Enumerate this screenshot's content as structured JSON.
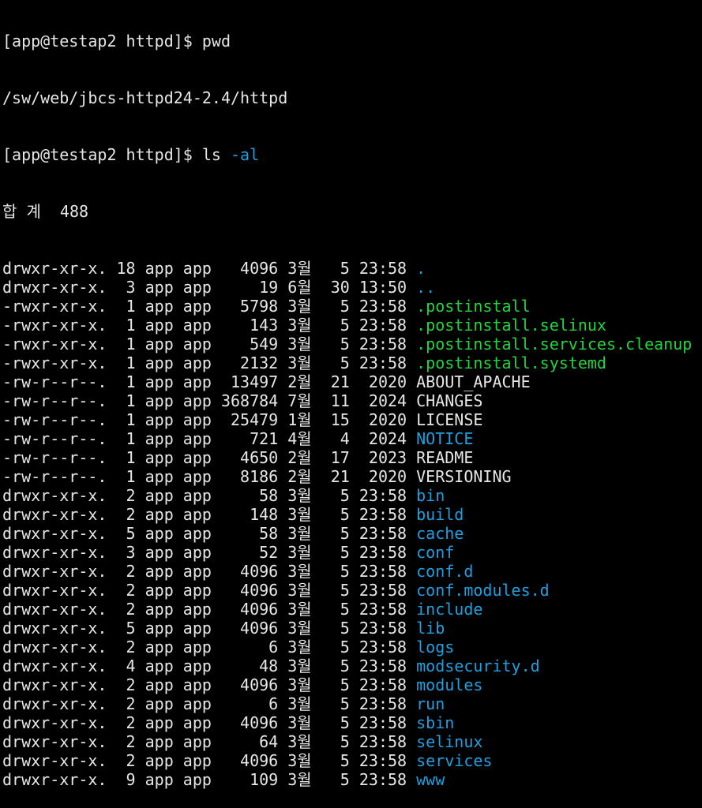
{
  "terminal": {
    "colors": {
      "background": "#000000",
      "foreground": "#e6e6e6",
      "directory": "#1ea0e0",
      "executable": "#1fd63d",
      "flag": "#1aa0dd"
    },
    "history": [
      {
        "prompt": "[app@testap2 httpd]$ ",
        "command": "pwd",
        "flag": ""
      },
      {
        "output": "/sw/web/jbcs-httpd24-2.4/httpd"
      },
      {
        "prompt": "[app@testap2 httpd]$ ",
        "command": "ls ",
        "flag": "-al"
      }
    ],
    "total_line": "합 계  488",
    "listing": [
      {
        "perms": "drwxr-xr-x.",
        "links": "18",
        "owner": "app",
        "group": "app",
        "size": "4096",
        "month": "3월",
        "day": "5",
        "time": "23:58",
        "name": ".",
        "kind": "dir"
      },
      {
        "perms": "drwxr-xr-x.",
        "links": "3",
        "owner": "app",
        "group": "app",
        "size": "19",
        "month": "6월",
        "day": "30",
        "time": "13:50",
        "name": "..",
        "kind": "dir"
      },
      {
        "perms": "-rwxr-xr-x.",
        "links": "1",
        "owner": "app",
        "group": "app",
        "size": "5798",
        "month": "3월",
        "day": "5",
        "time": "23:58",
        "name": ".postinstall",
        "kind": "exec"
      },
      {
        "perms": "-rwxr-xr-x.",
        "links": "1",
        "owner": "app",
        "group": "app",
        "size": "143",
        "month": "3월",
        "day": "5",
        "time": "23:58",
        "name": ".postinstall.selinux",
        "kind": "exec"
      },
      {
        "perms": "-rwxr-xr-x.",
        "links": "1",
        "owner": "app",
        "group": "app",
        "size": "549",
        "month": "3월",
        "day": "5",
        "time": "23:58",
        "name": ".postinstall.services.cleanup",
        "kind": "exec"
      },
      {
        "perms": "-rwxr-xr-x.",
        "links": "1",
        "owner": "app",
        "group": "app",
        "size": "2132",
        "month": "3월",
        "day": "5",
        "time": "23:58",
        "name": ".postinstall.systemd",
        "kind": "exec"
      },
      {
        "perms": "-rw-r--r--.",
        "links": "1",
        "owner": "app",
        "group": "app",
        "size": "13497",
        "month": "2월",
        "day": "21",
        "time": "2020",
        "name": "ABOUT_APACHE",
        "kind": "plain"
      },
      {
        "perms": "-rw-r--r--.",
        "links": "1",
        "owner": "app",
        "group": "app",
        "size": "368784",
        "month": "7월",
        "day": "11",
        "time": "2024",
        "name": "CHANGES",
        "kind": "plain"
      },
      {
        "perms": "-rw-r--r--.",
        "links": "1",
        "owner": "app",
        "group": "app",
        "size": "25479",
        "month": "1월",
        "day": "15",
        "time": "2020",
        "name": "LICENSE",
        "kind": "plain"
      },
      {
        "perms": "-rw-r--r--.",
        "links": "1",
        "owner": "app",
        "group": "app",
        "size": "721",
        "month": "4월",
        "day": "4",
        "time": "2024",
        "name": "NOTICE",
        "kind": "notice"
      },
      {
        "perms": "-rw-r--r--.",
        "links": "1",
        "owner": "app",
        "group": "app",
        "size": "4650",
        "month": "2월",
        "day": "17",
        "time": "2023",
        "name": "README",
        "kind": "plain"
      },
      {
        "perms": "-rw-r--r--.",
        "links": "1",
        "owner": "app",
        "group": "app",
        "size": "8186",
        "month": "2월",
        "day": "21",
        "time": "2020",
        "name": "VERSIONING",
        "kind": "plain"
      },
      {
        "perms": "drwxr-xr-x.",
        "links": "2",
        "owner": "app",
        "group": "app",
        "size": "58",
        "month": "3월",
        "day": "5",
        "time": "23:58",
        "name": "bin",
        "kind": "dir"
      },
      {
        "perms": "drwxr-xr-x.",
        "links": "2",
        "owner": "app",
        "group": "app",
        "size": "148",
        "month": "3월",
        "day": "5",
        "time": "23:58",
        "name": "build",
        "kind": "dir"
      },
      {
        "perms": "drwxr-xr-x.",
        "links": "5",
        "owner": "app",
        "group": "app",
        "size": "58",
        "month": "3월",
        "day": "5",
        "time": "23:58",
        "name": "cache",
        "kind": "dir"
      },
      {
        "perms": "drwxr-xr-x.",
        "links": "3",
        "owner": "app",
        "group": "app",
        "size": "52",
        "month": "3월",
        "day": "5",
        "time": "23:58",
        "name": "conf",
        "kind": "dir"
      },
      {
        "perms": "drwxr-xr-x.",
        "links": "2",
        "owner": "app",
        "group": "app",
        "size": "4096",
        "month": "3월",
        "day": "5",
        "time": "23:58",
        "name": "conf.d",
        "kind": "dir"
      },
      {
        "perms": "drwxr-xr-x.",
        "links": "2",
        "owner": "app",
        "group": "app",
        "size": "4096",
        "month": "3월",
        "day": "5",
        "time": "23:58",
        "name": "conf.modules.d",
        "kind": "dir"
      },
      {
        "perms": "drwxr-xr-x.",
        "links": "2",
        "owner": "app",
        "group": "app",
        "size": "4096",
        "month": "3월",
        "day": "5",
        "time": "23:58",
        "name": "include",
        "kind": "dir"
      },
      {
        "perms": "drwxr-xr-x.",
        "links": "5",
        "owner": "app",
        "group": "app",
        "size": "4096",
        "month": "3월",
        "day": "5",
        "time": "23:58",
        "name": "lib",
        "kind": "dir"
      },
      {
        "perms": "drwxr-xr-x.",
        "links": "2",
        "owner": "app",
        "group": "app",
        "size": "6",
        "month": "3월",
        "day": "5",
        "time": "23:58",
        "name": "logs",
        "kind": "dir"
      },
      {
        "perms": "drwxr-xr-x.",
        "links": "4",
        "owner": "app",
        "group": "app",
        "size": "48",
        "month": "3월",
        "day": "5",
        "time": "23:58",
        "name": "modsecurity.d",
        "kind": "dir"
      },
      {
        "perms": "drwxr-xr-x.",
        "links": "2",
        "owner": "app",
        "group": "app",
        "size": "4096",
        "month": "3월",
        "day": "5",
        "time": "23:58",
        "name": "modules",
        "kind": "dir"
      },
      {
        "perms": "drwxr-xr-x.",
        "links": "2",
        "owner": "app",
        "group": "app",
        "size": "6",
        "month": "3월",
        "day": "5",
        "time": "23:58",
        "name": "run",
        "kind": "dir"
      },
      {
        "perms": "drwxr-xr-x.",
        "links": "2",
        "owner": "app",
        "group": "app",
        "size": "4096",
        "month": "3월",
        "day": "5",
        "time": "23:58",
        "name": "sbin",
        "kind": "dir"
      },
      {
        "perms": "drwxr-xr-x.",
        "links": "2",
        "owner": "app",
        "group": "app",
        "size": "64",
        "month": "3월",
        "day": "5",
        "time": "23:58",
        "name": "selinux",
        "kind": "dir"
      },
      {
        "perms": "drwxr-xr-x.",
        "links": "2",
        "owner": "app",
        "group": "app",
        "size": "4096",
        "month": "3월",
        "day": "5",
        "time": "23:58",
        "name": "services",
        "kind": "dir"
      },
      {
        "perms": "drwxr-xr-x.",
        "links": "9",
        "owner": "app",
        "group": "app",
        "size": "109",
        "month": "3월",
        "day": "5",
        "time": "23:58",
        "name": "www",
        "kind": "dir"
      }
    ]
  }
}
